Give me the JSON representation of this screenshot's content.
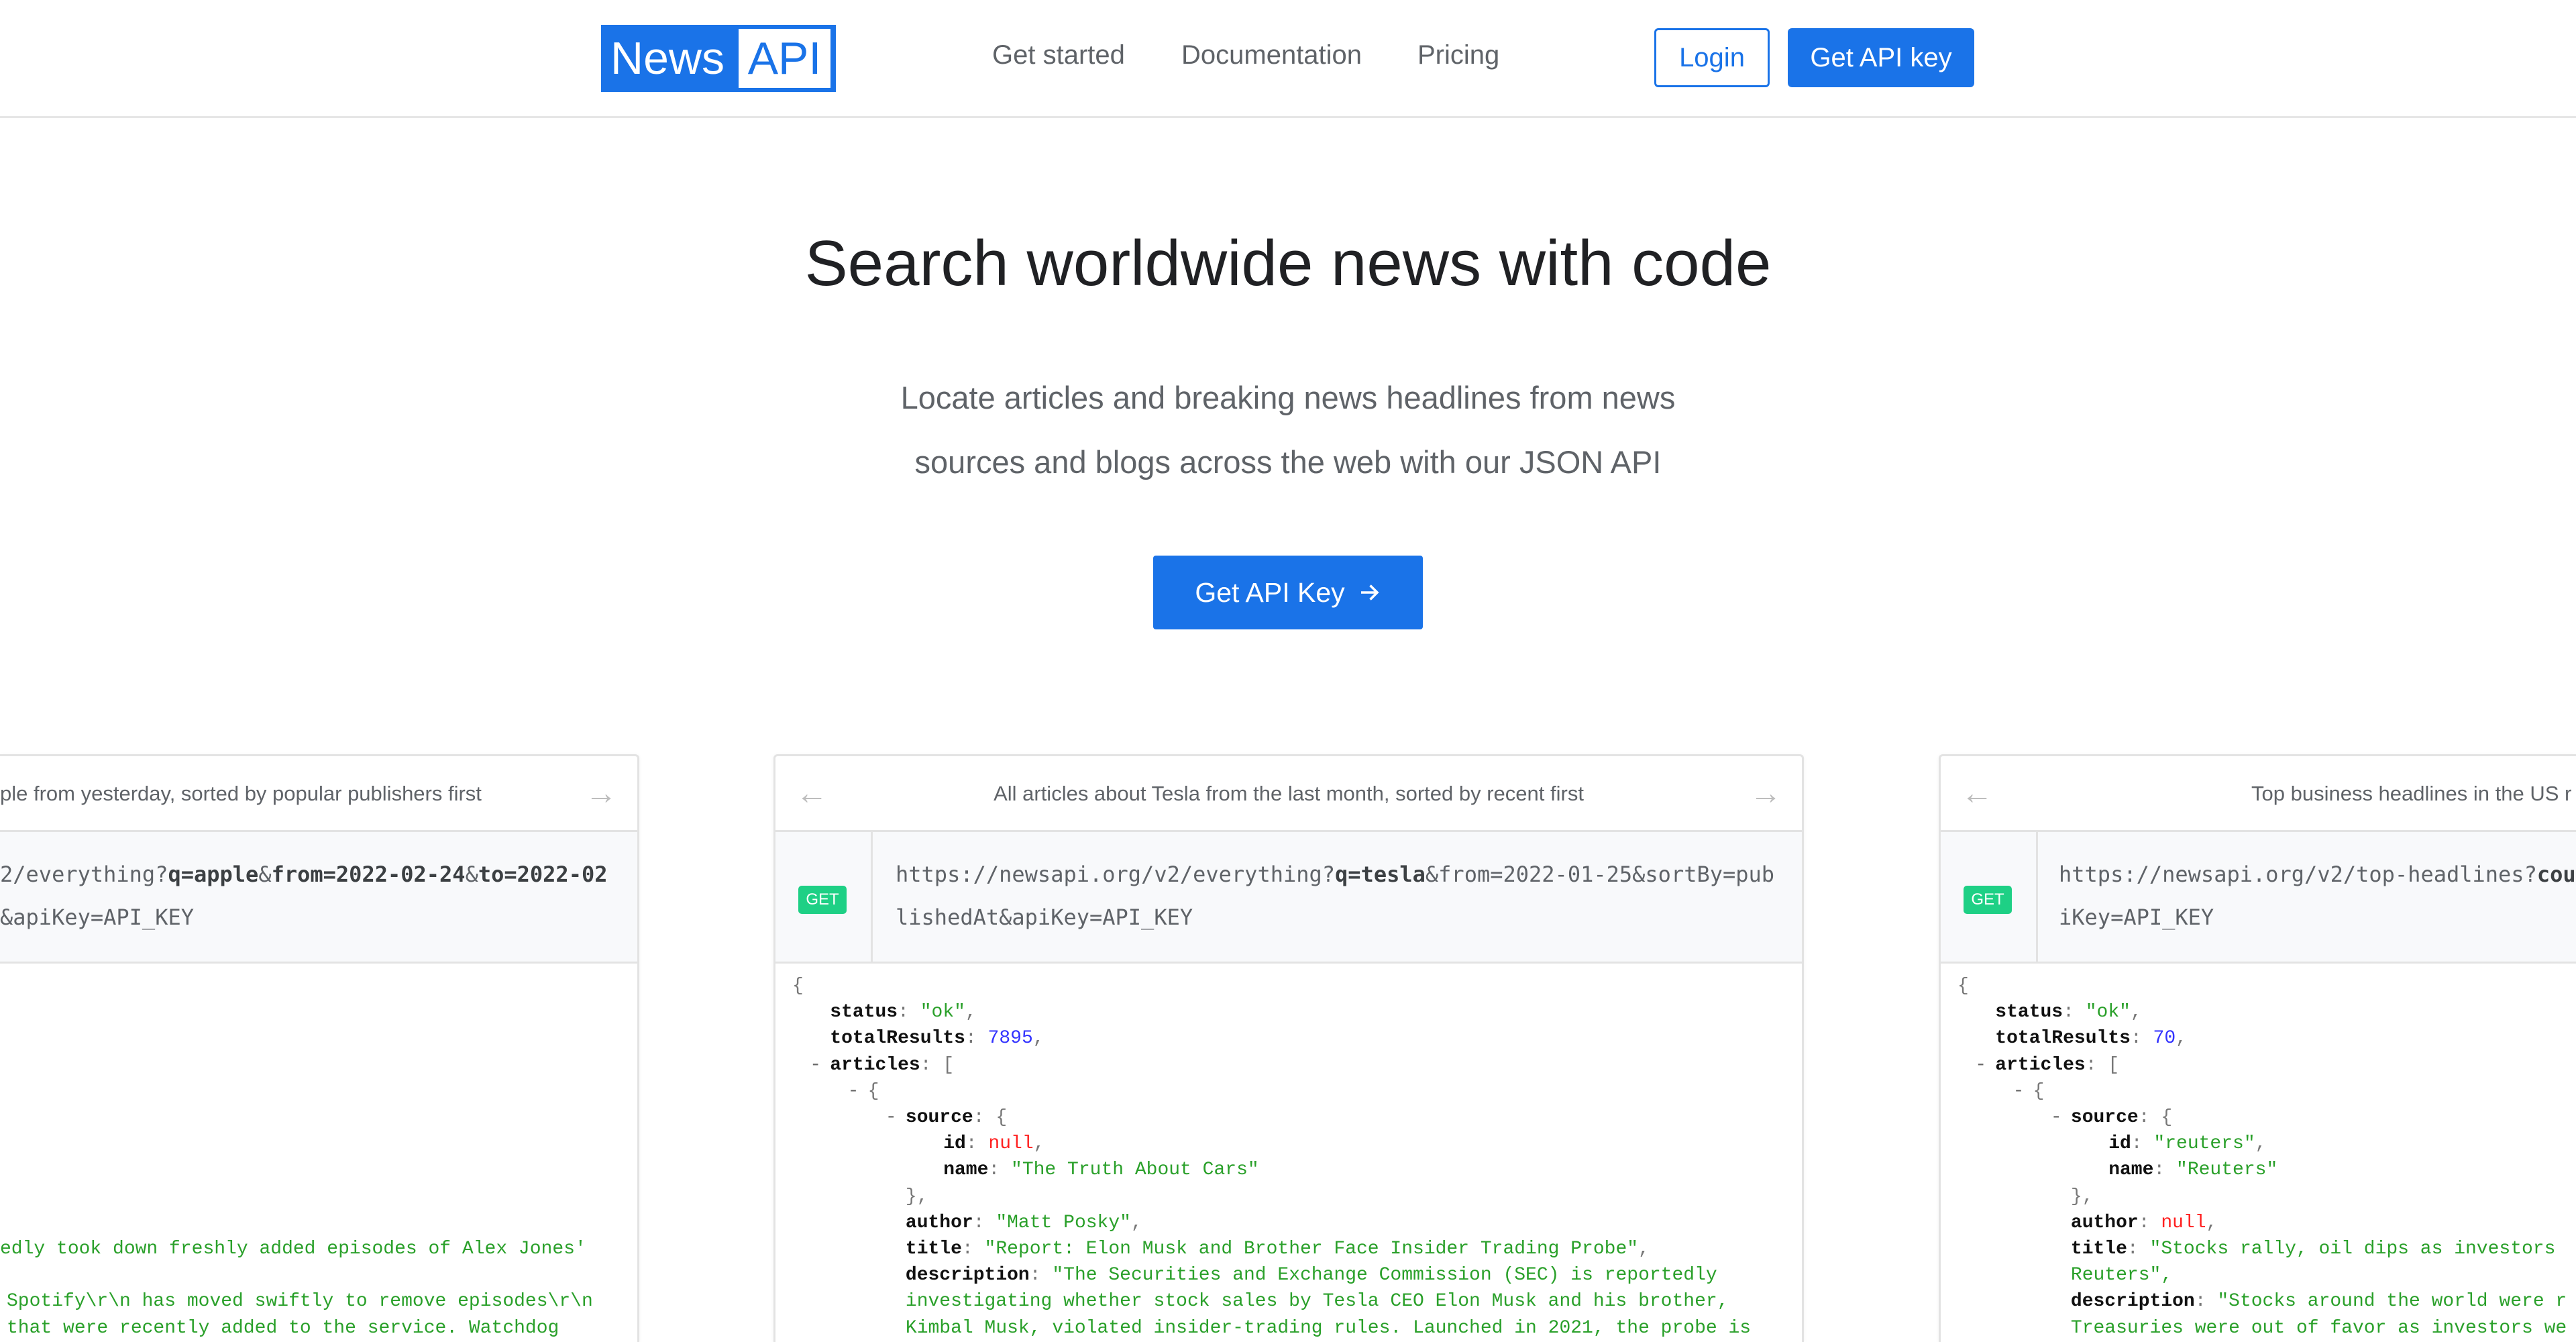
{
  "header": {
    "logo": {
      "left": "News",
      "right": "API"
    },
    "nav": [
      "Get started",
      "Documentation",
      "Pricing"
    ],
    "login": "Login",
    "get_key": "Get API key"
  },
  "hero": {
    "title": "Search worldwide news with code",
    "subtitle_lines": [
      "Locate articles and breaking news headlines from news",
      "sources and blogs across the web with our JSON API"
    ],
    "cta": "Get API Key",
    "cta_icon": "arrow-right-icon"
  },
  "colors": {
    "brand": "#1a73e8",
    "get_badge": "#1ed085",
    "string": "#2aa02a",
    "number": "#3333ff",
    "null": "#ff2020"
  },
  "cards": [
    {
      "title": "ple from yesterday, sorted by popular publishers first",
      "method": "",
      "url_lines": [
        [
          {
            "t": "2/everything?"
          },
          {
            "t": "q=apple",
            "b": true
          },
          {
            "t": "&"
          },
          {
            "t": "from=2022-02-24",
            "b": true
          },
          {
            "t": "&"
          },
          {
            "t": "to=2022-02",
            "b": true
          }
        ],
        [
          {
            "t": "&apiKey=API_KEY"
          }
        ]
      ],
      "json_lines": [
        {
          "row": 10,
          "x": 0,
          "v": "edly took down freshly added episodes of Alex Jones'",
          "t": "str"
        },
        {
          "row": 12,
          "x": 10,
          "v": "Spotify\\r\\n has moved swiftly to remove episodes\\r\\n",
          "t": "str"
        },
        {
          "row": 13,
          "x": 10,
          "v": "that were recently added to the service. Watchdog",
          "t": "str"
        }
      ]
    },
    {
      "title": "All articles about Tesla from the last month, sorted by recent first",
      "method": "GET",
      "url_lines": [
        [
          {
            "t": "https://newsapi.org/v2/everything?"
          },
          {
            "t": "q=tesla",
            "b": true
          },
          {
            "t": "&from=2022-01-25&sortBy=pub"
          }
        ],
        [
          {
            "t": "lishedAt&apiKey=API_KEY"
          }
        ]
      ],
      "json_lines": [
        {
          "row": 0,
          "l": 0,
          "p": "{"
        },
        {
          "row": 1,
          "l": 1,
          "k": "status",
          "v": "\"ok\"",
          "t": "str",
          "e": ","
        },
        {
          "row": 2,
          "l": 1,
          "k": "totalResults",
          "v": "7895",
          "t": "num",
          "e": ","
        },
        {
          "row": 3,
          "l": 1,
          "tog": true,
          "k": "articles",
          "p2": "["
        },
        {
          "row": 4,
          "l": 2,
          "tog": true,
          "p": "{"
        },
        {
          "row": 5,
          "l": 3,
          "tog": true,
          "k": "source",
          "p2": "{"
        },
        {
          "row": 6,
          "l": 4,
          "k": "id",
          "v": "null",
          "t": "null",
          "e": ","
        },
        {
          "row": 7,
          "l": 4,
          "k": "name",
          "v": "\"The Truth About Cars\"",
          "t": "str"
        },
        {
          "row": 8,
          "l": 3,
          "p": "},"
        },
        {
          "row": 9,
          "l": 3,
          "k": "author",
          "v": "\"Matt Posky\"",
          "t": "str",
          "e": ","
        },
        {
          "row": 10,
          "l": 3,
          "k": "title",
          "v": "\"Report: Elon Musk and Brother Face Insider Trading Probe\"",
          "t": "str",
          "e": ","
        },
        {
          "row": 11,
          "l": 3,
          "k": "description",
          "v": "\"The Securities and Exchange Commission (SEC) is reportedly",
          "t": "str"
        },
        {
          "row": 12,
          "l": 3,
          "v": "investigating whether stock sales by Tesla CEO Elon Musk and his brother,",
          "t": "str"
        },
        {
          "row": 13,
          "l": 3,
          "v": "Kimbal Musk, violated insider-trading rules. Launched in 2021, the probe is",
          "t": "str"
        }
      ]
    },
    {
      "title": "Top business headlines in the US r",
      "method": "GET",
      "url_lines": [
        [
          {
            "t": "https://newsapi.org/v2/top-headlines?"
          },
          {
            "t": "cou",
            "b": true
          }
        ],
        [
          {
            "t": "iKey=API_KEY"
          }
        ]
      ],
      "json_lines": [
        {
          "row": 0,
          "l": 0,
          "p": "{"
        },
        {
          "row": 1,
          "l": 1,
          "k": "status",
          "v": "\"ok\"",
          "t": "str",
          "e": ","
        },
        {
          "row": 2,
          "l": 1,
          "k": "totalResults",
          "v": "70",
          "t": "num",
          "e": ","
        },
        {
          "row": 3,
          "l": 1,
          "tog": true,
          "k": "articles",
          "p2": "["
        },
        {
          "row": 4,
          "l": 2,
          "tog": true,
          "p": "{"
        },
        {
          "row": 5,
          "l": 3,
          "tog": true,
          "k": "source",
          "p2": "{"
        },
        {
          "row": 6,
          "l": 4,
          "k": "id",
          "v": "\"reuters\"",
          "t": "str",
          "e": ","
        },
        {
          "row": 7,
          "l": 4,
          "k": "name",
          "v": "\"Reuters\"",
          "t": "str"
        },
        {
          "row": 8,
          "l": 3,
          "p": "},"
        },
        {
          "row": 9,
          "l": 3,
          "k": "author",
          "v": "null",
          "t": "null",
          "e": ","
        },
        {
          "row": 10,
          "l": 3,
          "k": "title",
          "v": "\"Stocks rally, oil dips as investors",
          "t": "str"
        },
        {
          "row": 11,
          "l": 3,
          "v": "Reuters\",",
          "t": "str"
        },
        {
          "row": 12,
          "l": 3,
          "k": "description",
          "v": "\"Stocks around the world were r",
          "t": "str"
        },
        {
          "row": 13,
          "l": 3,
          "v": "Treasuries were out of favor as investors we",
          "t": "str"
        }
      ]
    }
  ]
}
